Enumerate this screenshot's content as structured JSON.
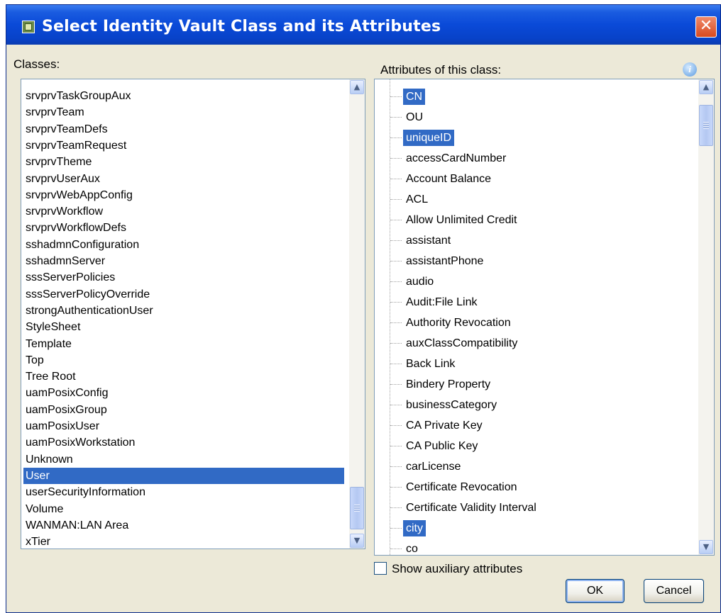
{
  "window": {
    "title": "Select Identity Vault Class and its Attributes",
    "close_glyph": "✕"
  },
  "classes": {
    "label": "Classes:",
    "items": [
      "srvprvTaskGroupAux",
      "srvprvTeam",
      "srvprvTeamDefs",
      "srvprvTeamRequest",
      "srvprvTheme",
      "srvprvUserAux",
      "srvprvWebAppConfig",
      "srvprvWorkflow",
      "srvprvWorkflowDefs",
      "sshadmnConfiguration",
      "sshadmnServer",
      "sssServerPolicies",
      "sssServerPolicyOverride",
      "strongAuthenticationUser",
      "StyleSheet",
      "Template",
      "Top",
      "Tree Root",
      "uamPosixConfig",
      "uamPosixGroup",
      "uamPosixUser",
      "uamPosixWorkstation",
      "Unknown",
      "User",
      "userSecurityInformation",
      "Volume",
      "WANMAN:LAN Area",
      "xTier"
    ],
    "selected": "User"
  },
  "attributes": {
    "label": "Attributes of this class:",
    "items": [
      {
        "name": "CN",
        "selected": true
      },
      {
        "name": "OU",
        "selected": false
      },
      {
        "name": "uniqueID",
        "selected": true
      },
      {
        "name": "accessCardNumber",
        "selected": false
      },
      {
        "name": "Account Balance",
        "selected": false
      },
      {
        "name": "ACL",
        "selected": false
      },
      {
        "name": "Allow Unlimited Credit",
        "selected": false
      },
      {
        "name": "assistant",
        "selected": false
      },
      {
        "name": "assistantPhone",
        "selected": false
      },
      {
        "name": "audio",
        "selected": false
      },
      {
        "name": "Audit:File Link",
        "selected": false
      },
      {
        "name": "Authority Revocation",
        "selected": false
      },
      {
        "name": "auxClassCompatibility",
        "selected": false
      },
      {
        "name": "Back Link",
        "selected": false
      },
      {
        "name": "Bindery Property",
        "selected": false
      },
      {
        "name": "businessCategory",
        "selected": false
      },
      {
        "name": "CA Private Key",
        "selected": false
      },
      {
        "name": "CA Public Key",
        "selected": false
      },
      {
        "name": "carLicense",
        "selected": false
      },
      {
        "name": "Certificate Revocation",
        "selected": false
      },
      {
        "name": "Certificate Validity Interval",
        "selected": false
      },
      {
        "name": "city",
        "selected": true
      },
      {
        "name": "co",
        "selected": false
      }
    ]
  },
  "show_auxiliary": {
    "label": "Show auxiliary attributes",
    "checked": false
  },
  "buttons": {
    "ok": "OK",
    "cancel": "Cancel"
  },
  "info_glyph": "i",
  "scroll_glyphs": {
    "up": "▲",
    "down": "▼"
  },
  "colors": {
    "selection": "#316ac5",
    "titlebar": "#0a4ad8",
    "dialog_bg": "#ece9d8"
  }
}
